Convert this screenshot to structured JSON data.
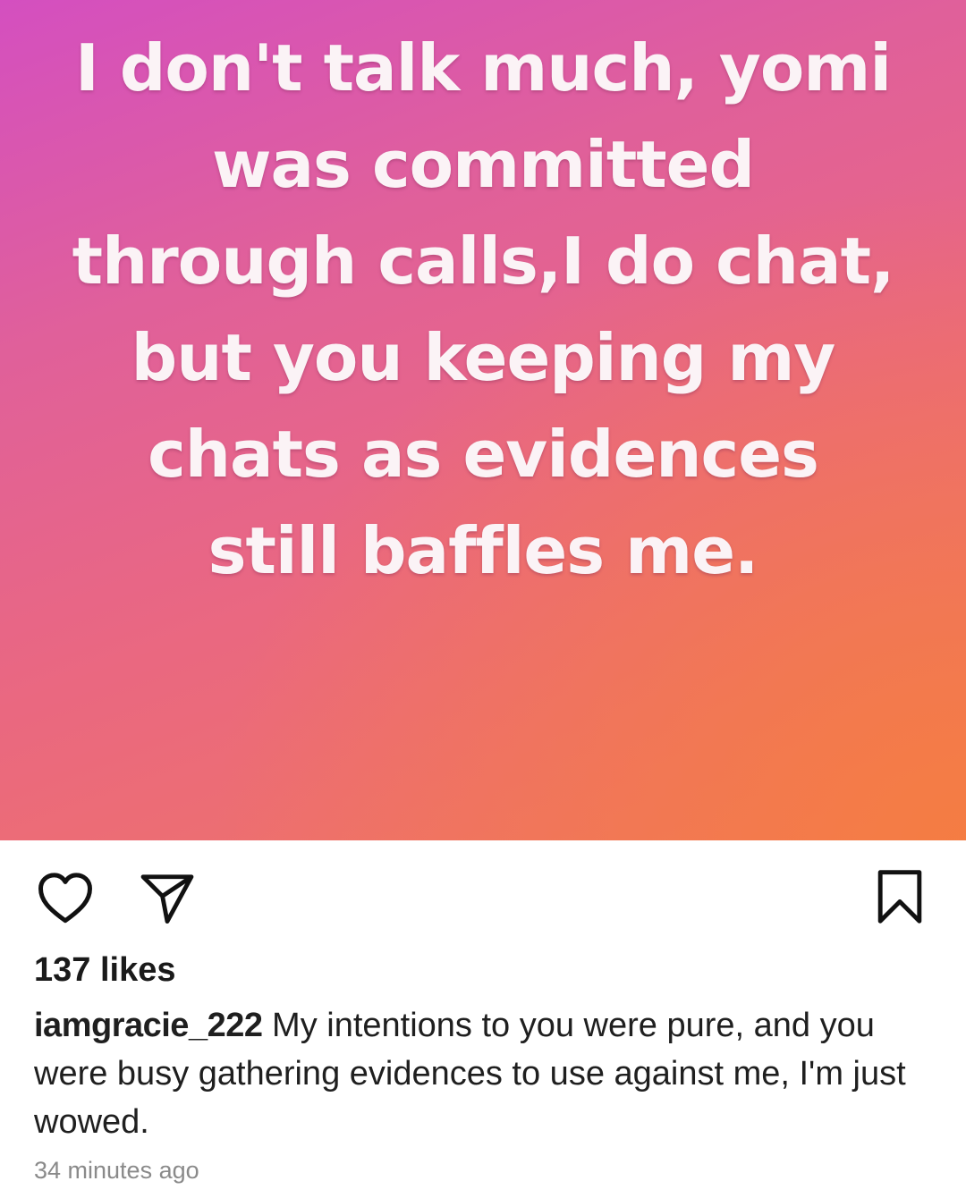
{
  "post": {
    "image_text_lines": [
      "I don't talk much, yomi",
      "was committed",
      "through calls,I do chat,",
      "but you keeping my",
      "chats as evidences",
      "still baffles me."
    ],
    "likes": "137 likes",
    "caption": {
      "username": "iamgracie_222",
      "text": "My intentions to you were pure, and you were busy gathering evidences to use against me, I'm just wowed."
    },
    "timestamp": "34 minutes ago"
  },
  "actions": {
    "like_icon": "heart-icon",
    "share_icon": "paper-plane-icon",
    "save_icon": "bookmark-icon"
  },
  "colors": {
    "gradient_start": "#d44fc0",
    "gradient_end": "#f57d41",
    "overlay_text": "#fbf3f6",
    "timestamp": "#8a8a8a"
  }
}
